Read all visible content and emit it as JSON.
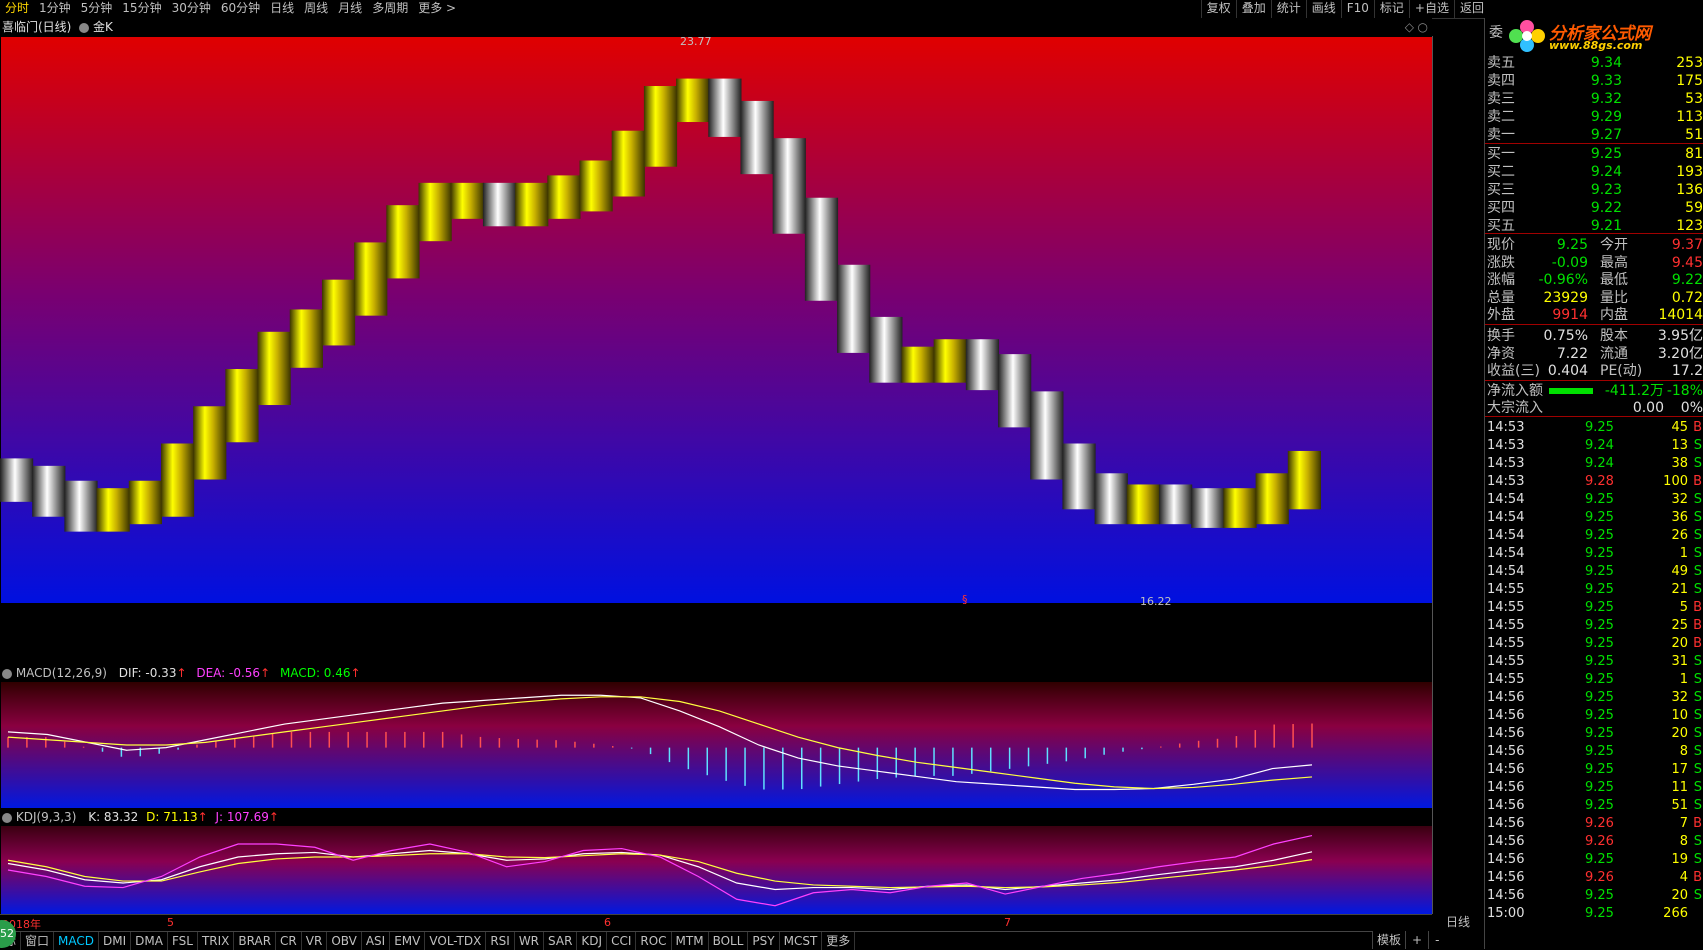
{
  "toolbar": {
    "period_tabs": [
      "分时",
      "1分钟",
      "5分钟",
      "15分钟",
      "30分钟",
      "60分钟",
      "日线",
      "周线",
      "月线",
      "多周期",
      "更多 >"
    ],
    "right_tools": [
      "复权",
      "叠加",
      "统计",
      "画线",
      "F10",
      "标记",
      "+自选",
      "返回"
    ]
  },
  "chart_header": {
    "title": "喜临门(日线)",
    "indicator_name": "金K"
  },
  "main_chart": {
    "y_ticks": [
      "23.50",
      "23.00",
      "22.50",
      "22.00",
      "21.50",
      "21.00",
      "20.50",
      "20.00",
      "19.50",
      "19.00",
      "18.50",
      "18.00",
      "17.50",
      "17.00",
      "16.50"
    ],
    "high_label": "23.77",
    "low_label": "16.22",
    "date_labels": [
      "2018年",
      "5",
      "6",
      "7"
    ],
    "marker": "§"
  },
  "macd": {
    "name": "MACD(12,26,9)",
    "dif": "DIF: -0.33",
    "dea": "DEA: -0.56",
    "macd": "MACD: 0.46",
    "y_ticks": [
      "1.00",
      "0.50",
      "0.00",
      "-0.50"
    ]
  },
  "kdj": {
    "name": "KDJ(9,3,3)",
    "k": "K: 83.32",
    "d": "D: 71.13",
    "j": "J: 107.69",
    "y_ticks": [
      "100.00",
      "80.00",
      "50.00",
      "20.00",
      "0.00"
    ]
  },
  "bottom_tabs": [
    "标",
    "窗口",
    "MACD",
    "DMI",
    "DMA",
    "FSL",
    "TRIX",
    "BRAR",
    "CR",
    "VR",
    "OBV",
    "ASI",
    "EMV",
    "VOL-TDX",
    "RSI",
    "WR",
    "SAR",
    "KDJ",
    "CCI",
    "ROC",
    "MTM",
    "BOLL",
    "PSY",
    "MCST",
    "更多"
  ],
  "bottom_right": {
    "template": "模板",
    "plus": "+",
    "minus": "-",
    "period": "日线"
  },
  "badge": "52",
  "quote": {
    "logo": "分析家公式网",
    "logo_url": "www.88gs.com",
    "wei_label": "委",
    "asks": [
      {
        "label": "卖五",
        "price": "9.34",
        "vol": "253"
      },
      {
        "label": "卖四",
        "price": "9.33",
        "vol": "175"
      },
      {
        "label": "卖三",
        "price": "9.32",
        "vol": "53"
      },
      {
        "label": "卖二",
        "price": "9.29",
        "vol": "113"
      },
      {
        "label": "卖一",
        "price": "9.27",
        "vol": "51"
      }
    ],
    "bids": [
      {
        "label": "买一",
        "price": "9.25",
        "vol": "81"
      },
      {
        "label": "买二",
        "price": "9.24",
        "vol": "193"
      },
      {
        "label": "买三",
        "price": "9.23",
        "vol": "136"
      },
      {
        "label": "买四",
        "price": "9.22",
        "vol": "59"
      },
      {
        "label": "买五",
        "price": "9.21",
        "vol": "123"
      }
    ],
    "stats": [
      {
        "l1": "现价",
        "v1": "9.25",
        "l2": "今开",
        "v2": "9.37"
      },
      {
        "l1": "涨跌",
        "v1": "-0.09",
        "l2": "最高",
        "v2": "9.45"
      },
      {
        "l1": "涨幅",
        "v1": "-0.96%",
        "l2": "最低",
        "v2": "9.22"
      },
      {
        "l1": "总量",
        "v1": "23929",
        "l2": "量比",
        "v2": "0.72"
      },
      {
        "l1": "外盘",
        "v1": "9914",
        "l2": "内盘",
        "v2": "14014"
      }
    ],
    "stats2": [
      {
        "l1": "换手",
        "v1": "0.75%",
        "l2": "股本",
        "v2": "3.95亿"
      },
      {
        "l1": "净资",
        "v1": "7.22",
        "l2": "流通",
        "v2": "3.20亿"
      },
      {
        "l1": "收益(三)",
        "v1": "0.404",
        "l2": "PE(动)",
        "v2": "17.2"
      }
    ],
    "flow": [
      {
        "label": "净流入额",
        "value": "-411.2万",
        "pct": "-18%"
      },
      {
        "label": "大宗流入",
        "value": "0.00",
        "pct": "0%"
      }
    ],
    "ticks": [
      {
        "t": "14:53",
        "p": "9.25",
        "v": "45",
        "f": "B"
      },
      {
        "t": "14:53",
        "p": "9.24",
        "v": "13",
        "f": "S"
      },
      {
        "t": "14:53",
        "p": "9.24",
        "v": "38",
        "f": "S"
      },
      {
        "t": "14:53",
        "p": "9.28",
        "v": "100",
        "f": "B"
      },
      {
        "t": "14:54",
        "p": "9.25",
        "v": "32",
        "f": "S"
      },
      {
        "t": "14:54",
        "p": "9.25",
        "v": "36",
        "f": "S"
      },
      {
        "t": "14:54",
        "p": "9.25",
        "v": "26",
        "f": "S"
      },
      {
        "t": "14:54",
        "p": "9.25",
        "v": "1",
        "f": "S"
      },
      {
        "t": "14:54",
        "p": "9.25",
        "v": "49",
        "f": "S"
      },
      {
        "t": "14:55",
        "p": "9.25",
        "v": "21",
        "f": "S"
      },
      {
        "t": "14:55",
        "p": "9.25",
        "v": "5",
        "f": "B"
      },
      {
        "t": "14:55",
        "p": "9.25",
        "v": "25",
        "f": "B"
      },
      {
        "t": "14:55",
        "p": "9.25",
        "v": "20",
        "f": "B"
      },
      {
        "t": "14:55",
        "p": "9.25",
        "v": "31",
        "f": "S"
      },
      {
        "t": "14:55",
        "p": "9.25",
        "v": "1",
        "f": "S"
      },
      {
        "t": "14:56",
        "p": "9.25",
        "v": "32",
        "f": "S"
      },
      {
        "t": "14:56",
        "p": "9.25",
        "v": "10",
        "f": "S"
      },
      {
        "t": "14:56",
        "p": "9.25",
        "v": "20",
        "f": "S"
      },
      {
        "t": "14:56",
        "p": "9.25",
        "v": "8",
        "f": "S"
      },
      {
        "t": "14:56",
        "p": "9.25",
        "v": "17",
        "f": "S"
      },
      {
        "t": "14:56",
        "p": "9.25",
        "v": "11",
        "f": "S"
      },
      {
        "t": "14:56",
        "p": "9.25",
        "v": "51",
        "f": "S"
      },
      {
        "t": "14:56",
        "p": "9.26",
        "v": "7",
        "f": "B"
      },
      {
        "t": "14:56",
        "p": "9.26",
        "v": "8",
        "f": "S"
      },
      {
        "t": "14:56",
        "p": "9.25",
        "v": "19",
        "f": "S"
      },
      {
        "t": "14:56",
        "p": "9.26",
        "v": "4",
        "f": "B"
      },
      {
        "t": "14:56",
        "p": "9.25",
        "v": "20",
        "f": "S"
      },
      {
        "t": "15:00",
        "p": "9.25",
        "v": "266",
        "f": ""
      }
    ]
  },
  "chart_data": [
    {
      "type": "line",
      "ylim": [
        16.2,
        23.8
      ],
      "series": [
        {
          "values": [
            17.9,
            17.8,
            17.6,
            17.4,
            17.5,
            17.6,
            18.1,
            18.6,
            19.1,
            19.6,
            19.9,
            20.3,
            20.8,
            21.3,
            21.6,
            21.6,
            21.5,
            21.6,
            21.7,
            21.9,
            22.3,
            22.9,
            23.0,
            22.7,
            22.2,
            21.4,
            20.5,
            19.8,
            19.4,
            19.4,
            19.5,
            19.3,
            18.8,
            18.1,
            17.7,
            17.5,
            17.55,
            17.5,
            17.45,
            17.5,
            17.7,
            18.0
          ]
        }
      ]
    },
    {
      "type": "line",
      "ylim": [
        -1.0,
        1.1
      ],
      "series": [
        {
          "values": [
            0.3,
            0.25,
            0.1,
            -0.05,
            0.0,
            0.15,
            0.3,
            0.45,
            0.55,
            0.65,
            0.75,
            0.85,
            0.9,
            0.95,
            1.0,
            1.0,
            0.95,
            0.7,
            0.4,
            0.05,
            -0.2,
            -0.35,
            -0.45,
            -0.55,
            -0.65,
            -0.7,
            -0.75,
            -0.8,
            -0.8,
            -0.78,
            -0.7,
            -0.6,
            -0.4,
            -0.33
          ]
        },
        {
          "values": [
            0.2,
            0.15,
            0.1,
            0.05,
            0.05,
            0.1,
            0.2,
            0.3,
            0.4,
            0.5,
            0.6,
            0.7,
            0.8,
            0.87,
            0.93,
            0.97,
            0.97,
            0.88,
            0.7,
            0.45,
            0.2,
            0.0,
            -0.15,
            -0.28,
            -0.38,
            -0.48,
            -0.58,
            -0.68,
            -0.75,
            -0.78,
            -0.76,
            -0.7,
            -0.62,
            -0.56
          ]
        }
      ]
    },
    {
      "type": "line",
      "ylim": [
        0,
        100
      ],
      "series": [
        {
          "values": [
            65,
            55,
            40,
            35,
            40,
            60,
            75,
            80,
            82,
            75,
            80,
            85,
            80,
            70,
            72,
            80,
            82,
            78,
            60,
            35,
            25,
            28,
            28,
            25,
            30,
            32,
            25,
            30,
            35,
            40,
            48,
            55,
            60,
            70,
            83
          ]
        },
        {
          "values": [
            70,
            60,
            45,
            38,
            38,
            52,
            65,
            72,
            75,
            75,
            77,
            80,
            80,
            75,
            74,
            77,
            80,
            78,
            68,
            50,
            38,
            32,
            30,
            28,
            29,
            30,
            28,
            29,
            32,
            36,
            42,
            48,
            55,
            62,
            71
          ]
        },
        {
          "values": [
            55,
            45,
            30,
            28,
            45,
            75,
            95,
            95,
            90,
            70,
            85,
            95,
            82,
            60,
            68,
            85,
            88,
            75,
            45,
            10,
            0,
            20,
            25,
            20,
            30,
            35,
            18,
            30,
            42,
            50,
            60,
            68,
            75,
            95,
            108
          ]
        }
      ]
    }
  ]
}
